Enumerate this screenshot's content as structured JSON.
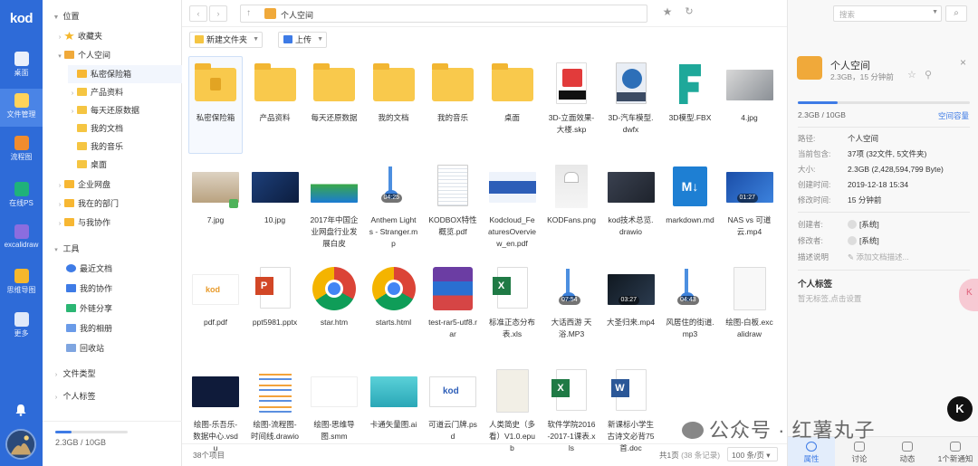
{
  "rail": {
    "logo": "kod",
    "items": [
      {
        "label": "桌面",
        "icon": "monitor-icon",
        "active": false
      },
      {
        "label": "文件管理",
        "icon": "folder-icon",
        "active": true
      },
      {
        "label": "流程图",
        "icon": "flowchart-icon",
        "active": false
      },
      {
        "label": "在线PS",
        "icon": "ps-icon",
        "active": false
      },
      {
        "label": "excalidraw",
        "icon": "excalidraw-icon",
        "active": false
      },
      {
        "label": "思维导图",
        "icon": "mindmap-icon",
        "active": false
      },
      {
        "label": "更多",
        "icon": "grid-icon",
        "active": false
      }
    ]
  },
  "tree": {
    "location": "位置",
    "favorites": "收藏夹",
    "personal": "个人空间",
    "children": [
      "私密保险箱",
      "产品资料",
      "每天还原数据",
      "我的文档",
      "我的音乐",
      "桌面"
    ],
    "enterprise": "企业网盘",
    "dept": "我在的部门",
    "collab": "与我协作",
    "tools": "工具",
    "tool_items": [
      "最近文档",
      "我的协作",
      "外链分享",
      "我的相册",
      "回收站"
    ],
    "filetype": "文件类型",
    "tags": "个人标签",
    "usage": "2.3GB / 10GB",
    "usage_fraction": 0.23
  },
  "address": {
    "crumb": "个人空间"
  },
  "toolbar": {
    "new_folder": "新建文件夹",
    "upload": "上传"
  },
  "files": [
    {
      "name": "私密保险箱",
      "kind": "folder-lock",
      "badge": ""
    },
    {
      "name": "产品资料",
      "kind": "folder",
      "badge": ""
    },
    {
      "name": "每天还原数据",
      "kind": "folder",
      "badge": ""
    },
    {
      "name": "我的文档",
      "kind": "folder",
      "badge": ""
    },
    {
      "name": "我的音乐",
      "kind": "folder",
      "badge": ""
    },
    {
      "name": "桌面",
      "kind": "folder",
      "badge": ""
    },
    {
      "name": "3D-立面效果-大楼.skp",
      "kind": "skp",
      "badge": ""
    },
    {
      "name": "3D-汽车模型.dwfx",
      "kind": "dwf",
      "badge": ""
    },
    {
      "name": "3D模型.FBX",
      "kind": "fbx",
      "badge": ""
    },
    {
      "name": "4.jpg",
      "kind": "img-cat",
      "badge": ""
    },
    {
      "name": "7.jpg",
      "kind": "img-beach",
      "badge": ""
    },
    {
      "name": "10.jpg",
      "kind": "img-night",
      "badge": ""
    },
    {
      "name": "2017年中国企业网盘行业发展白皮",
      "kind": "img-report",
      "badge": ""
    },
    {
      "name": "Anthem Lights - Stranger.mp",
      "kind": "audio",
      "badge": "04:25"
    },
    {
      "name": "KODBOX特性概览.pdf",
      "kind": "pdf-doc",
      "badge": ""
    },
    {
      "name": "Kodcloud_FeaturesOverview_en.pdf",
      "kind": "img-web",
      "badge": ""
    },
    {
      "name": "KODFans.png",
      "kind": "img-cap",
      "badge": ""
    },
    {
      "name": "kod技术总览.drawio",
      "kind": "img-dark",
      "badge": ""
    },
    {
      "name": "markdown.md",
      "kind": "markdown",
      "badge": ""
    },
    {
      "name": "NAS vs 可道云.mp4",
      "kind": "video-blue",
      "badge": "01:27"
    },
    {
      "name": "pdf.pdf",
      "kind": "img-kod",
      "badge": ""
    },
    {
      "name": "ppt5981.pptx",
      "kind": "pptx",
      "badge": ""
    },
    {
      "name": "star.htm",
      "kind": "chrome",
      "badge": ""
    },
    {
      "name": "starts.html",
      "kind": "chrome",
      "badge": ""
    },
    {
      "name": "test-rar5-utf8.rar",
      "kind": "rar",
      "badge": ""
    },
    {
      "name": "标准正态分布表.xls",
      "kind": "xls",
      "badge": ""
    },
    {
      "name": "大话西游 天浴.MP3",
      "kind": "audio",
      "badge": "07:54"
    },
    {
      "name": "大圣归来.mp4",
      "kind": "video-dark",
      "badge": "03:27"
    },
    {
      "name": "风居住的街道.mp3",
      "kind": "audio",
      "badge": "04:43"
    },
    {
      "name": "绘图-白板.excalidraw",
      "kind": "img-white",
      "badge": ""
    },
    {
      "name": "绘图-乐吾乐-数据中心.vsdu",
      "kind": "img-navy",
      "badge": ""
    },
    {
      "name": "绘图-流程图-时间线.drawio",
      "kind": "img-timeline",
      "badge": ""
    },
    {
      "name": "绘图-思维导图.smm",
      "kind": "img-mind",
      "badge": ""
    },
    {
      "name": "卡通矢量图.ai",
      "kind": "img-cartoon",
      "badge": ""
    },
    {
      "name": "可道云门牌.psd",
      "kind": "img-sign",
      "badge": ""
    },
    {
      "name": "人类简史（多看）V1.0.epub",
      "kind": "img-book",
      "badge": ""
    },
    {
      "name": "软件学院2016-2017-1课表.xls",
      "kind": "xls",
      "badge": ""
    },
    {
      "name": "新课标小学生古诗文必背75首.doc",
      "kind": "doc",
      "badge": ""
    }
  ],
  "status": {
    "count": "38个项目",
    "pages": "共1页",
    "records": "(38 条记录)",
    "per_page": "100 条/页"
  },
  "right": {
    "search_placeholder": "搜索",
    "title": "个人空间",
    "subtitle": "2.3GB，15 分钟前",
    "quota": "2.3GB / 10GB",
    "quota_fraction": 0.23,
    "quota_link": "空间容量",
    "props": [
      {
        "k": "路径:",
        "v": "个人空间"
      },
      {
        "k": "当前包含:",
        "v": "37项 (32文件, 5文件夹)"
      },
      {
        "k": "大小:",
        "v": "2.3GB (2,428,594,799 Byte)"
      },
      {
        "k": "创建时间:",
        "v": "2019-12-18 15:34"
      },
      {
        "k": "修改时间:",
        "v": "15 分钟前"
      }
    ],
    "people": [
      {
        "k": "创建者:",
        "v": "[系统]"
      },
      {
        "k": "修改者:",
        "v": "[系统]"
      },
      {
        "k": "描述说明",
        "v": "添加文档描述..."
      }
    ],
    "tag_title": "个人标签",
    "tag_hint": "暂无标签,点击设置",
    "tabs": [
      "属性",
      "讨论",
      "动态",
      "1个新通知"
    ]
  },
  "overlay": {
    "watermark": "公众号 · 红薯丸子",
    "hk": "K",
    "bubble": "K"
  }
}
